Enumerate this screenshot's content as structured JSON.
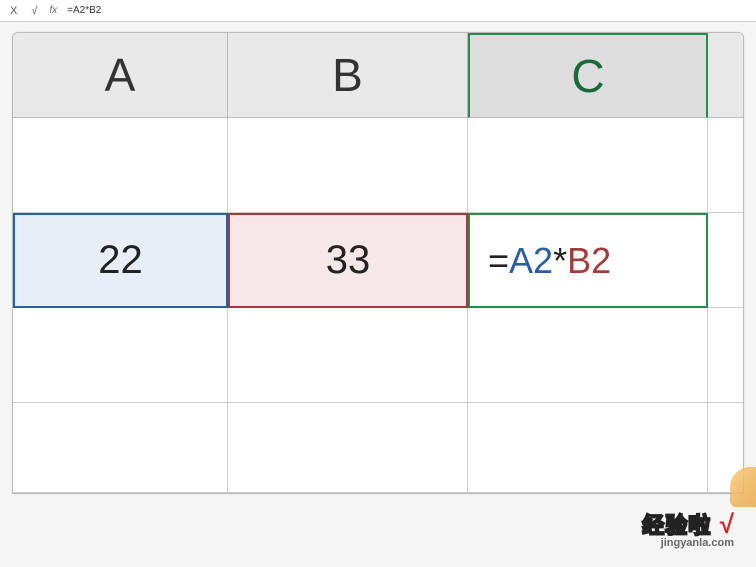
{
  "formula_bar": {
    "cancel": "X",
    "confirm": "√",
    "fx": "fx",
    "value": "=A2*B2"
  },
  "headers": {
    "a": "A",
    "b": "B",
    "c": "C"
  },
  "cells": {
    "a2": "22",
    "b2": "33",
    "c2": {
      "eq": "=",
      "ref1": "A2",
      "op": "*",
      "ref2": "B2"
    }
  },
  "watermark": {
    "brand": "经验啦",
    "check": "√",
    "site": "jingyanla.com"
  }
}
